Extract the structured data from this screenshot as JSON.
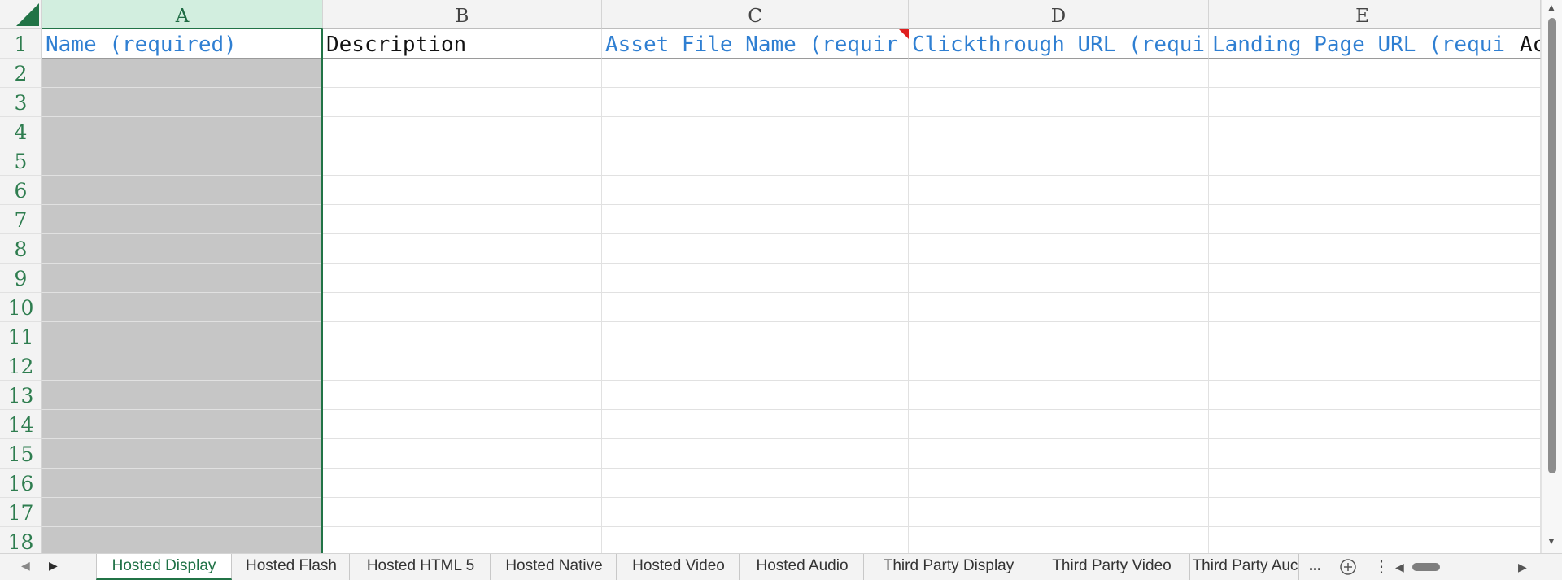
{
  "columns": [
    {
      "letter": "A"
    },
    {
      "letter": "B"
    },
    {
      "letter": "C"
    },
    {
      "letter": "D"
    },
    {
      "letter": "E"
    }
  ],
  "header_row": [
    {
      "text": "Name (required)",
      "required": true
    },
    {
      "text": "Description",
      "required": false
    },
    {
      "text": "Asset File Name (requir",
      "required": true
    },
    {
      "text": "Clickthrough URL (requi",
      "required": true
    },
    {
      "text": "Landing Page URL (requi",
      "required": true
    },
    {
      "text": "Ac",
      "required": false
    }
  ],
  "row_numbers": [
    "1",
    "2",
    "3",
    "4",
    "5",
    "6",
    "7",
    "8",
    "9",
    "10",
    "11",
    "12",
    "13",
    "14",
    "15",
    "16",
    "17",
    "18"
  ],
  "sheet_tabs": [
    {
      "label": "Hosted Display",
      "active": true
    },
    {
      "label": "Hosted Flash",
      "active": false
    },
    {
      "label": "Hosted HTML 5",
      "active": false
    },
    {
      "label": "Hosted Native",
      "active": false
    },
    {
      "label": "Hosted Video",
      "active": false
    },
    {
      "label": "Hosted Audio",
      "active": false
    },
    {
      "label": "Third Party Display",
      "active": false
    },
    {
      "label": "Third Party Video",
      "active": false
    },
    {
      "label": "Third Party Auc",
      "active": false
    }
  ],
  "overflow_label": "...",
  "icons": {
    "add_sheet": "plus-circle-icon",
    "more_sheets": "vertical-dots-icon",
    "scroll_left": "triangle-left-icon",
    "scroll_right": "triangle-right-icon"
  },
  "colors": {
    "accent": "#217346",
    "required_text": "#2f7fd2",
    "comment_flag": "#e02020",
    "locked_column": "#c6c6c6"
  }
}
